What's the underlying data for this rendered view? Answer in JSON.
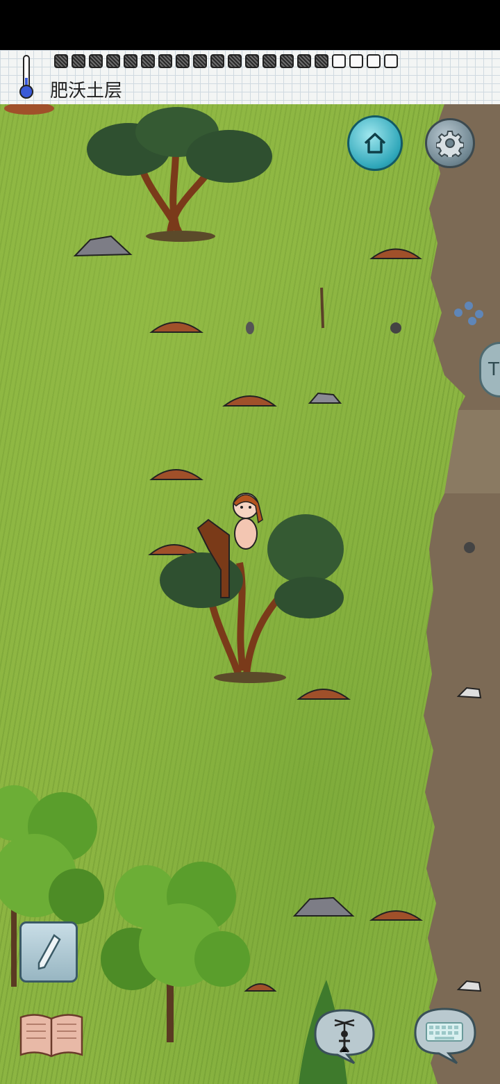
{
  "hud": {
    "biome_label": "肥沃土层",
    "hunger_pips": [
      1,
      1,
      1,
      1,
      1,
      1,
      1,
      1,
      1,
      1,
      1,
      1,
      1,
      1,
      1,
      1,
      0,
      0,
      0,
      0
    ],
    "thermometer": "thermometer-icon"
  },
  "buttons": {
    "home": "home-icon",
    "settings": "gear-icon",
    "side_tab_letter": "T",
    "pencil": "pencil-icon",
    "book": "book-icon",
    "puppet": "puppet-icon",
    "keyboard": "keyboard-icon"
  },
  "colors": {
    "grass": "#8cb542",
    "dirt": "#7c6a55",
    "home_button": "#2ea6b9",
    "settings_button": "#6e8590"
  }
}
